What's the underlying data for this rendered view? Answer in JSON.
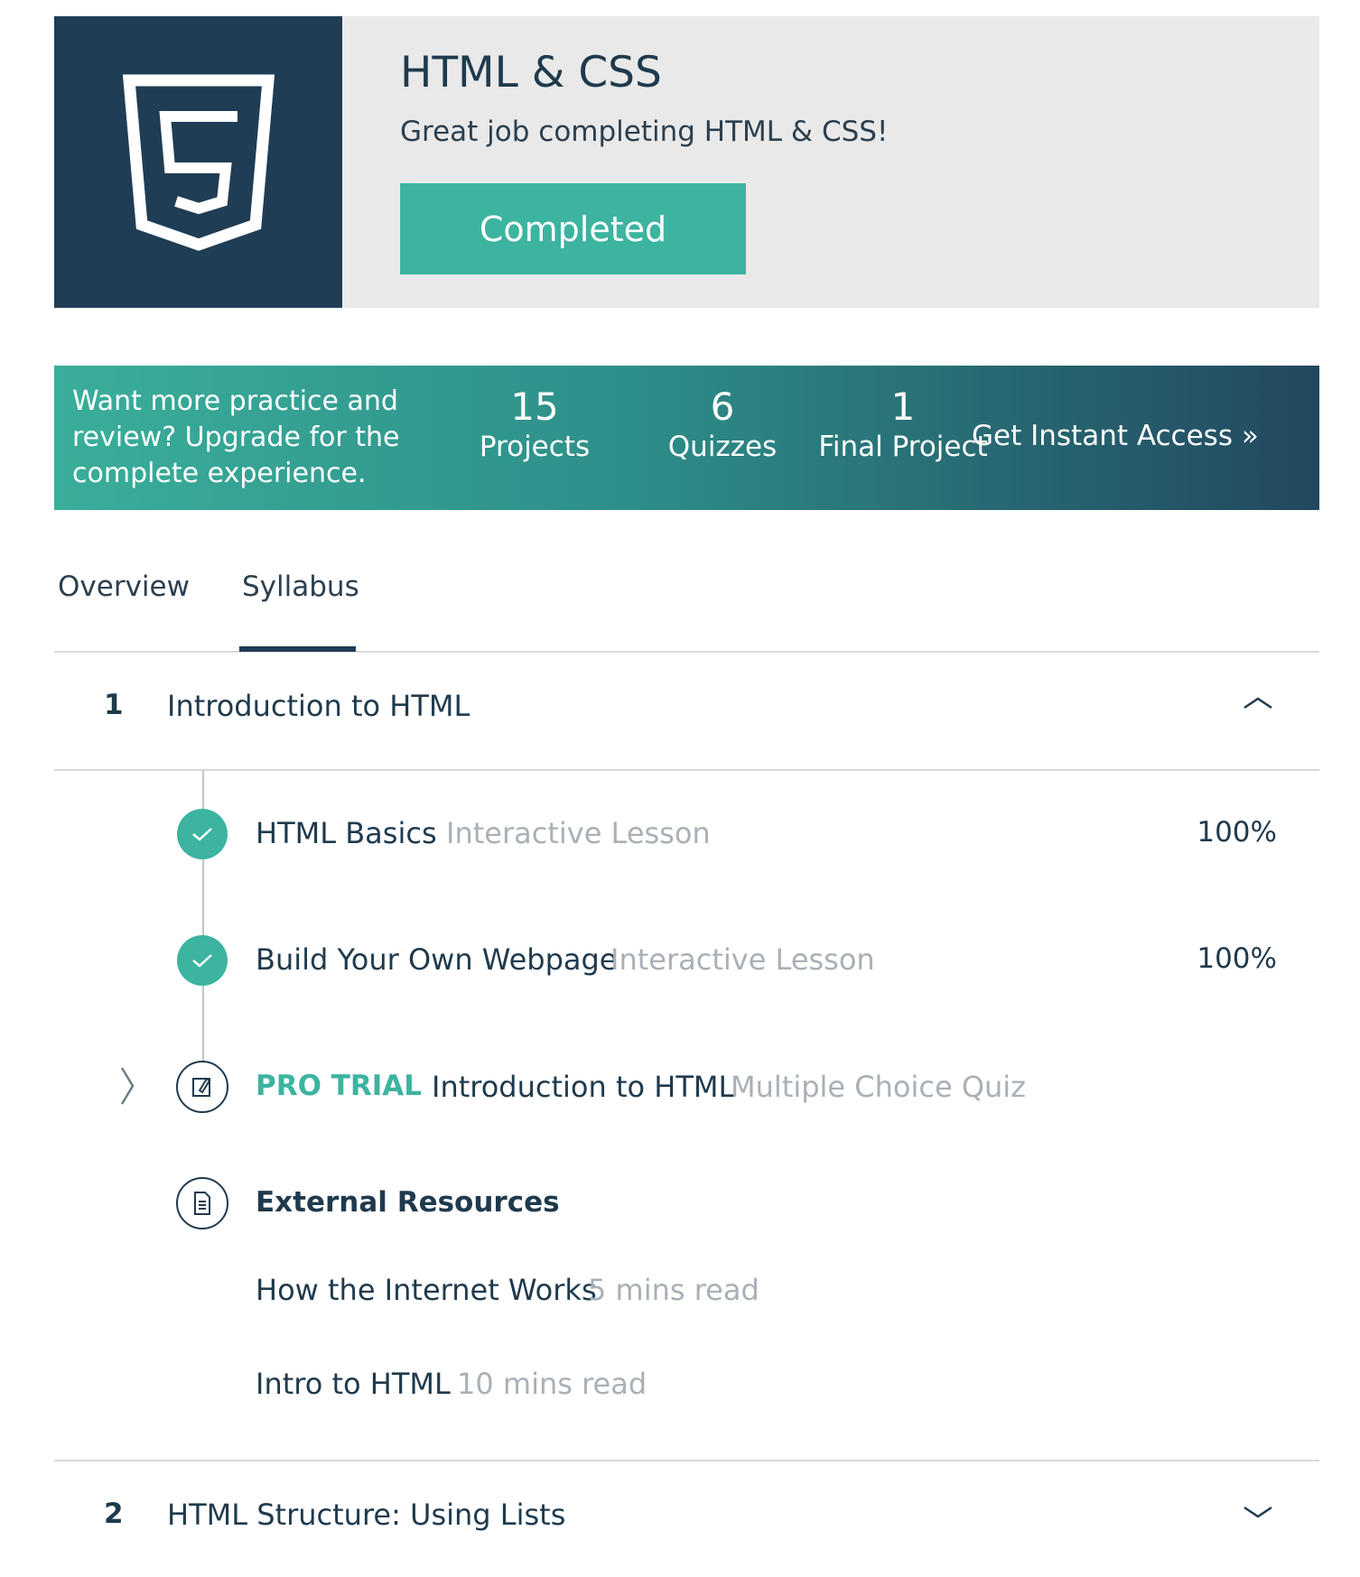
{
  "course": {
    "title": "HTML & CSS",
    "subtitle": "Great job completing HTML & CSS!",
    "status_button": "Completed",
    "logo_icon": "html5-shield-icon"
  },
  "banner": {
    "text": "Want more practice and review? Upgrade for the complete experience.",
    "stats": [
      {
        "num": "15",
        "label": "Projects"
      },
      {
        "num": "6",
        "label": "Quizzes"
      },
      {
        "num": "1",
        "label": "Final Project"
      }
    ],
    "cta": "Get Instant Access »"
  },
  "tabs": [
    {
      "label": "Overview",
      "active": false
    },
    {
      "label": "Syllabus",
      "active": true
    }
  ],
  "sections": [
    {
      "number": "1",
      "title": "Introduction to HTML",
      "expanded": true,
      "items": [
        {
          "title": "HTML Basics",
          "type": "Interactive Lesson",
          "progress": "100%",
          "done": true
        },
        {
          "title": "Build Your Own Webpage",
          "type": "Interactive Lesson",
          "progress": "100%",
          "done": true
        },
        {
          "badge": "PRO TRIAL",
          "title": "Introduction to HTML",
          "type": "Multiple Choice Quiz",
          "icon": "quiz-edit-icon"
        }
      ],
      "resources": {
        "heading": "External Resources",
        "icon": "document-icon",
        "links": [
          {
            "title": "How the Internet Works",
            "meta": "5 mins read"
          },
          {
            "title": "Intro to HTML",
            "meta": "10 mins read"
          }
        ]
      }
    },
    {
      "number": "2",
      "title": "HTML Structure: Using Lists",
      "expanded": false
    }
  ],
  "colors": {
    "navy": "#1f3d55",
    "teal": "#3cb4a0",
    "muted": "#a9b0b6"
  }
}
